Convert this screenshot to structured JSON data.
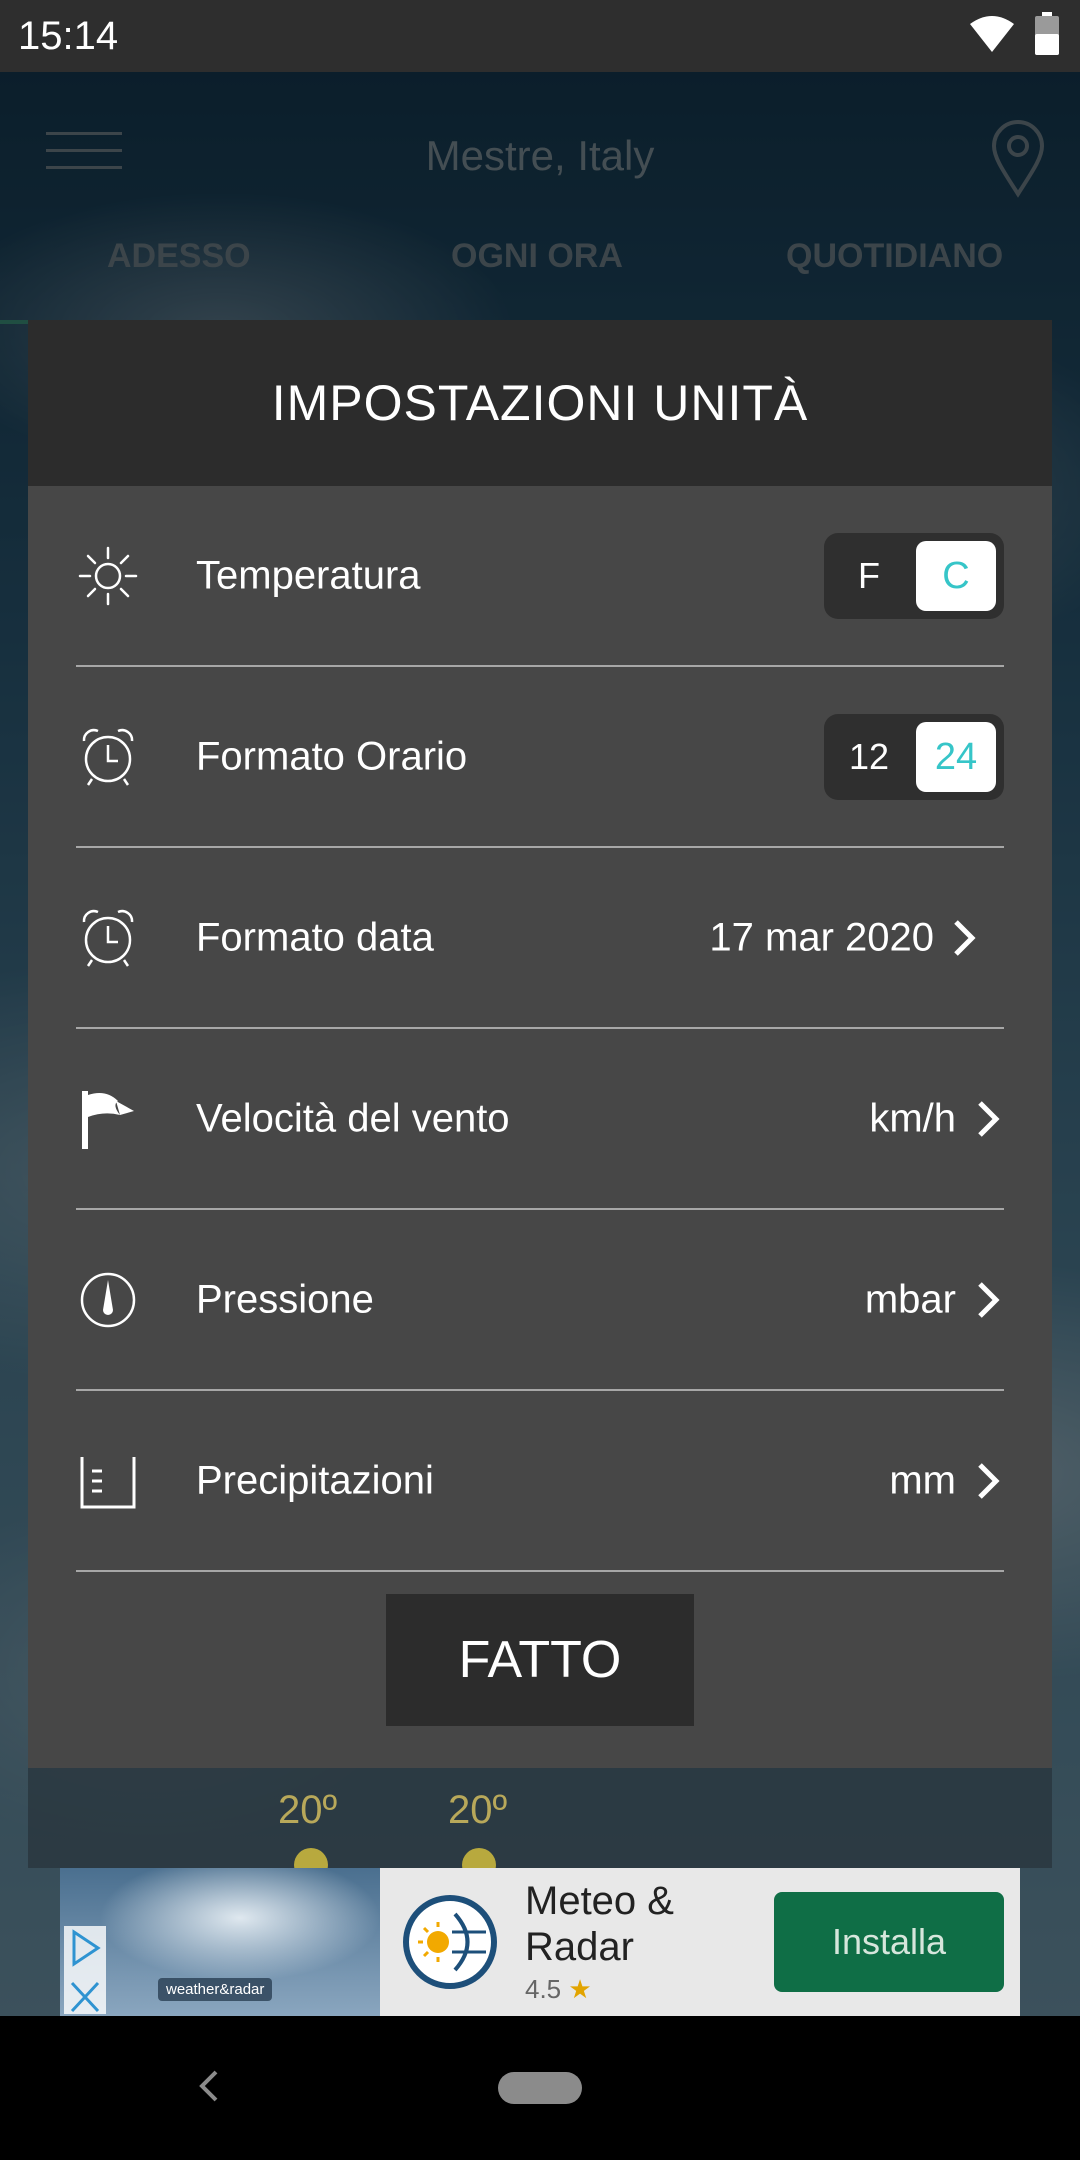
{
  "status_bar": {
    "time": "15:14",
    "icons": [
      "wifi-icon",
      "battery-icon"
    ]
  },
  "app_header": {
    "location": "Mestre, Italy"
  },
  "tabs": [
    {
      "label": "ADESSO"
    },
    {
      "label": "OGNI ORA"
    },
    {
      "label": "QUOTIDIANO"
    }
  ],
  "dialog": {
    "title": "IMPOSTAZIONI UNITÀ",
    "rows": [
      {
        "label": "Temperatura",
        "icon": "sun-icon",
        "options": [
          "F",
          "C"
        ],
        "selected": "C"
      },
      {
        "label": "Formato Orario",
        "icon": "alarm-clock-icon",
        "options": [
          "12",
          "24"
        ],
        "selected": "24"
      },
      {
        "label": "Formato data",
        "icon": "alarm-clock-icon",
        "value": "17 mar 2020"
      },
      {
        "label": "Velocità del vento",
        "icon": "wind-flag-icon",
        "value": "km/h"
      },
      {
        "label": "Pressione",
        "icon": "gauge-icon",
        "value": "mbar"
      },
      {
        "label": "Precipitazioni",
        "icon": "rain-gauge-icon",
        "value": "mm"
      }
    ],
    "done_label": "FATTO"
  },
  "forecast_strip": {
    "temps": [
      "20º",
      "20º"
    ]
  },
  "ad": {
    "brand": "weather&radar",
    "app_name_line1": "Meteo &",
    "app_name_line2": "Radar",
    "rating": "4.5",
    "install_label": "Installa"
  },
  "colors": {
    "accent_toggle": "#36c5c8",
    "dialog_bg": "#474747",
    "dialog_header": "#2c2c2c",
    "install_btn": "#0f6e46"
  }
}
